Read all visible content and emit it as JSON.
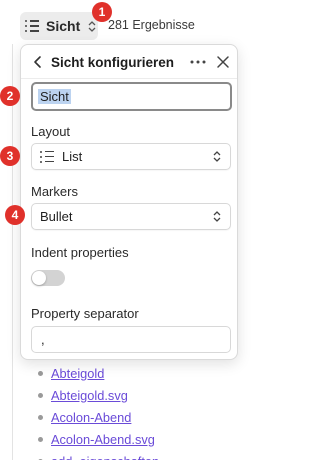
{
  "toolbar": {
    "view_label": "Sicht",
    "results": "281 Ergebnisse"
  },
  "popover": {
    "title": "Sicht konfigurieren",
    "name_value": "Sicht",
    "layout_label": "Layout",
    "layout_value": "List",
    "markers_label": "Markers",
    "markers_value": "Bullet",
    "indent_label": "Indent properties",
    "indent_on": false,
    "separator_label": "Property separator",
    "separator_value": ","
  },
  "badges": [
    "1",
    "2",
    "3",
    "4"
  ],
  "files": [
    "Abteigold",
    "Abteigold.svg",
    "Acolon-Abend",
    "Acolon-Abend.svg",
    "add_eigenschaften"
  ],
  "colors": {
    "badge": "#e0312b",
    "link": "#6a4bd8",
    "selection": "#bcd3f0"
  }
}
